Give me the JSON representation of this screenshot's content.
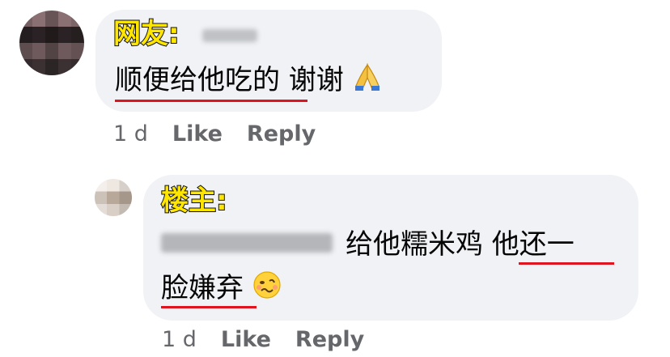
{
  "comments": [
    {
      "author_label": "网友:",
      "text": "顺便给他吃的 谢谢",
      "emoji": "folded-hands-icon",
      "time": "1 d",
      "like": "Like",
      "reply": "Reply"
    },
    {
      "author_label": "楼主:",
      "text_line1": "给他糯米鸡 他还一",
      "text_line2": "脸嫌弃",
      "emoji": "woozy-face-icon",
      "time": "1 d",
      "like": "Like",
      "reply": "Reply"
    }
  ],
  "colors": {
    "bubble": "#f0f2f5",
    "meta": "#65676b",
    "highlight_underline": "#e0141e",
    "label_fill": "#ffe600"
  }
}
